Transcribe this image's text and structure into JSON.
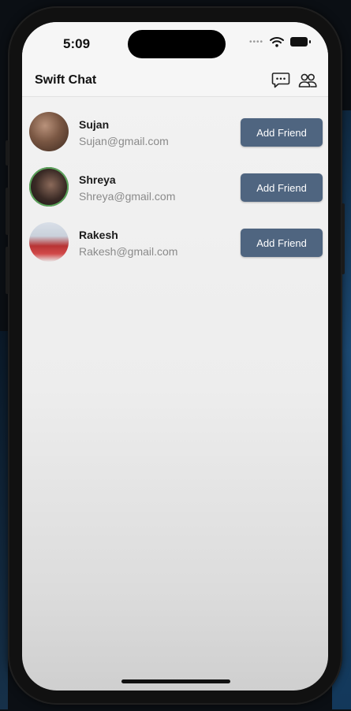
{
  "status_bar": {
    "time": "5:09",
    "signal_icon": "signal-dots-icon",
    "wifi_icon": "wifi-icon",
    "battery_icon": "battery-icon"
  },
  "nav": {
    "title": "Swift Chat",
    "chat_icon": "chat-bubble-icon",
    "friends_icon": "people-icon"
  },
  "users": [
    {
      "name": "Sujan",
      "email": "Sujan@gmail.com",
      "button": "Add Friend"
    },
    {
      "name": "Shreya",
      "email": "Shreya@gmail.com",
      "button": "Add Friend"
    },
    {
      "name": "Rakesh",
      "email": "Rakesh@gmail.com",
      "button": "Add Friend"
    }
  ],
  "colors": {
    "button_bg": "#4f6580",
    "button_text": "#ffffff",
    "screen_bg": "#f0f0f0"
  }
}
